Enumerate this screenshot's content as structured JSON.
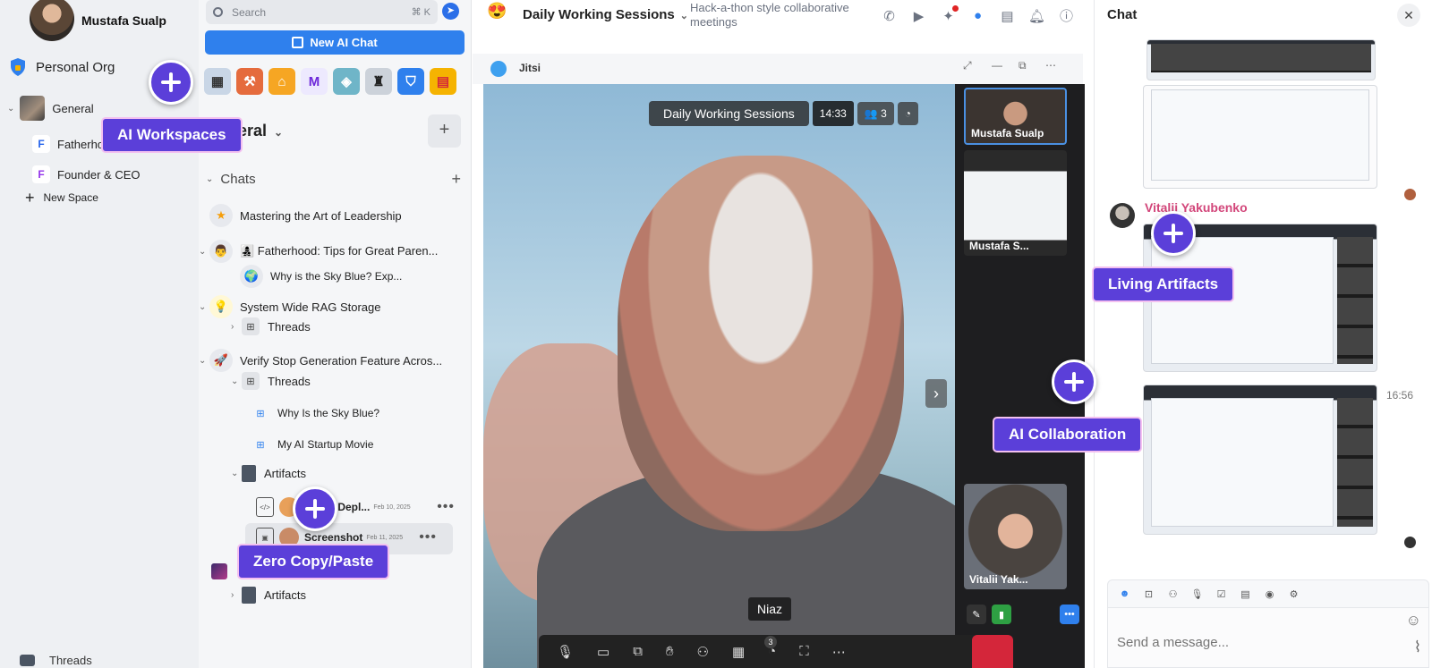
{
  "user": {
    "name": "Mustafa Sualp"
  },
  "org": {
    "label": "Personal Org"
  },
  "workspace": {
    "label": "General",
    "spaces": [
      {
        "badge": "F",
        "label": "Fatherho",
        "color": "#2563eb"
      },
      {
        "badge": "F",
        "label": "Founder & CEO",
        "color": "#9333ea"
      }
    ],
    "new_space": "New Space",
    "threads_label": "Threads"
  },
  "mid": {
    "search_placeholder": "Search",
    "search_shortcut": "⌘ K",
    "new_ai_chat": "New AI Chat",
    "title": "eral",
    "chats_header": "Chats",
    "rows": {
      "mastering": "Mastering the Art of Leadership",
      "fatherhood": "👩‍👧‍👦 Fatherhood: Tips for Great Paren...",
      "sky_blue_exp": "Why is the Sky Blue? Exp...",
      "rag": "System Wide RAG Storage",
      "threads_a": "Threads",
      "verify": "Verify Stop Generation Feature Acros...",
      "threads_b": "Threads",
      "sky_blue": "Why Is the Sky Blue?",
      "startup_movie": "My AI Startup Movie",
      "artifacts_a": "Artifacts",
      "deploy_file": "or Depl...",
      "deploy_date": "Feb 10, 2025",
      "screenshot_file": "Screenshot",
      "screenshot_date": "Feb 11, 2025",
      "artifacts_b": "Artifacts"
    }
  },
  "header": {
    "title": "Daily Working Sessions",
    "subtitle": "Hack-a-thon style collaborative meetings"
  },
  "jitsi": {
    "label": "Jitsi",
    "meeting_name": "Daily Working Sessions",
    "timer": "14:33",
    "participant_count": "3",
    "tile_1": "Mustafa Sualp",
    "tile_2": "Mustafa S...",
    "tile_3": "Vitalii Yak...",
    "speaker": "Niaz",
    "toolbar_badge": "3"
  },
  "chat": {
    "title": "Chat",
    "sender": "Vitalii Yakubenko",
    "time": "16:56",
    "placeholder": "Send a message..."
  },
  "callouts": {
    "ai_workspaces": "AI Workspaces",
    "living_artifacts": "Living Artifacts",
    "ai_collaboration": "AI Collaboration",
    "zero_copy_paste": "Zero Copy/Paste"
  },
  "colors": {
    "accent": "#2f80ed",
    "callout": "#5b3fd9",
    "sender": "#d2467a",
    "hangup": "#d4263a"
  }
}
